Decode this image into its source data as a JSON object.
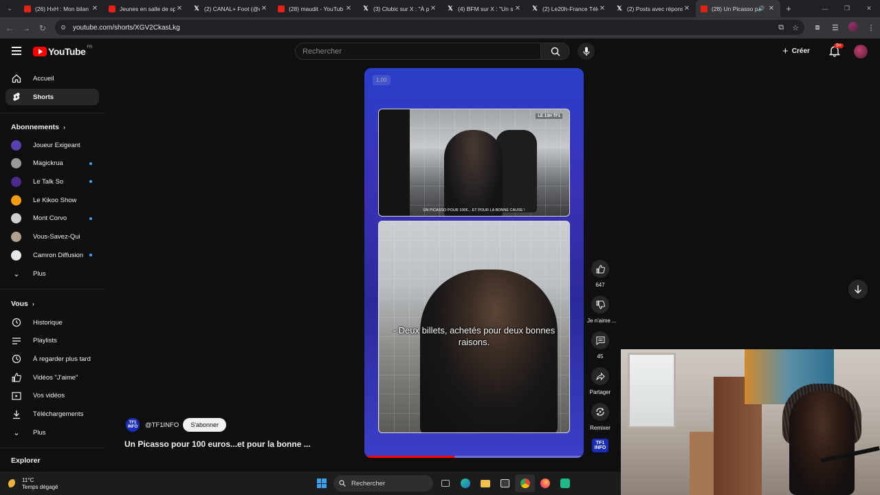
{
  "browser": {
    "tabs": [
      {
        "title": "(26) HxH : Mon bilan",
        "fav": "yt"
      },
      {
        "title": "Jeunes en salle de sp",
        "fav": "yt"
      },
      {
        "title": "(2) CANAL+ Foot (@c",
        "fav": "x"
      },
      {
        "title": "(28) maudit - YouTub",
        "fav": "yt"
      },
      {
        "title": "(3) Clubic sur X : \"À p",
        "fav": "x"
      },
      {
        "title": "(4) BFM sur X : \"Un s",
        "fav": "x"
      },
      {
        "title": "(2) Le20h-France Télé",
        "fav": "x"
      },
      {
        "title": "(2) Posts avec répons",
        "fav": "x"
      },
      {
        "title": "(28) Un Picasso p",
        "fav": "yt",
        "active": true
      }
    ],
    "url": "youtube.com/shorts/XGV2CkasLkg"
  },
  "header": {
    "logo_text": "YouTube",
    "region": "FR",
    "search_placeholder": "Rechercher",
    "create_label": "Créer",
    "notif_badge": "9+"
  },
  "sidebar": {
    "main": [
      {
        "label": "Accueil",
        "icon": "home-icon"
      },
      {
        "label": "Shorts",
        "icon": "shorts-icon",
        "active": true
      }
    ],
    "subs_heading": "Abonnements",
    "subscriptions": [
      {
        "label": "Joueur Exigeant",
        "color": "#5a3fb0",
        "dot": false
      },
      {
        "label": "Magickrua",
        "color": "#9a9a9a",
        "dot": true
      },
      {
        "label": "Le Talk So",
        "color": "#4a2a8a",
        "dot": true
      },
      {
        "label": "Le Kikoo Show",
        "color": "#f39c12",
        "dot": false
      },
      {
        "label": "Mont Corvo",
        "color": "#cfcfcf",
        "dot": true
      },
      {
        "label": "Vous-Savez-Qui",
        "color": "#b0a090",
        "dot": false
      },
      {
        "label": "Camron Diffusion",
        "color": "#e8e8e8",
        "dot": true
      }
    ],
    "subs_more": "Plus",
    "you_heading": "Vous",
    "you_items": [
      {
        "label": "Historique",
        "icon": "history-icon"
      },
      {
        "label": "Playlists",
        "icon": "playlists-icon"
      },
      {
        "label": "À regarder plus tard",
        "icon": "watch-later-icon"
      },
      {
        "label": "Vidéos \"J'aime\"",
        "icon": "liked-videos-icon"
      },
      {
        "label": "Vos vidéos",
        "icon": "your-videos-icon"
      },
      {
        "label": "Téléchargements",
        "icon": "downloads-icon"
      }
    ],
    "you_more": "Plus",
    "explore_heading": "Explorer"
  },
  "short": {
    "speed": "1.00",
    "subtitle_small": "UN PICASSO POUR 100€... ET POUR LA BONNE CAUSE !",
    "subtitle_main": "- Deux billets, achetés pour deux bonnes raisons.",
    "channel_handle": "@TF1INFO",
    "subscribe_label": "S'abonner",
    "title": "Un Picasso pour 100 euros...et pour la bonne ...",
    "progress": 0.41,
    "tf1_text": "TF1 INFO",
    "tf1_small_logo": "LE 13H TF1"
  },
  "actions": {
    "like_count": "647",
    "dislike_label": "Je n'aime ...",
    "comments_count": "45",
    "share_label": "Partager",
    "remix_label": "Remixer"
  },
  "taskbar": {
    "temp": "11°C",
    "weather": "Temps dégagé",
    "search_label": "Rechercher"
  }
}
